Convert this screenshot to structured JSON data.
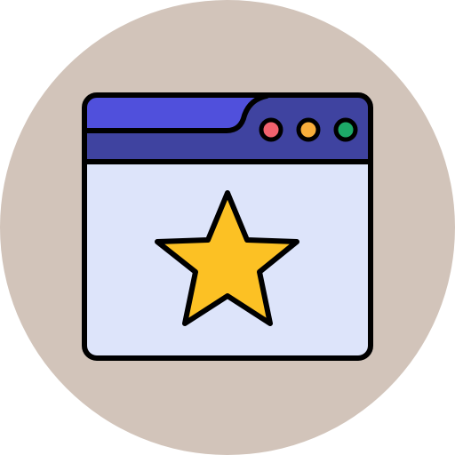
{
  "icon": {
    "name": "browser-window-star-icon",
    "colors": {
      "background_circle": "#D2C4BA",
      "window_body": "#DDE4FA",
      "title_bar": "#3F43A0",
      "title_bar_tab": "#5050DC",
      "outline": "#000000",
      "star": "#FCC124",
      "dot_red": "#F0626E",
      "dot_orange": "#F8AE3B",
      "dot_green": "#1DA968"
    },
    "window_controls": [
      "red-dot",
      "orange-dot",
      "green-dot"
    ],
    "content_icon": "star-icon"
  }
}
